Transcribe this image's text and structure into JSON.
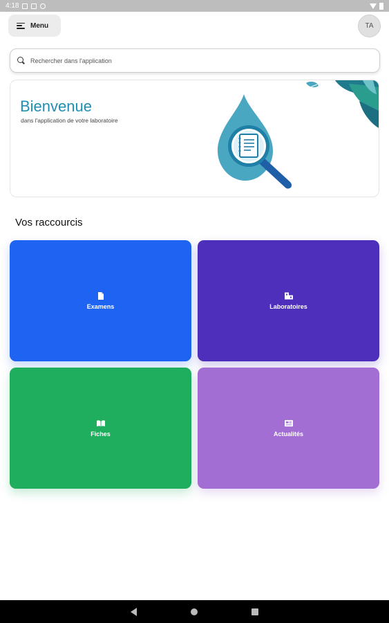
{
  "status_bar": {
    "time": "4:18",
    "icons": [
      "notification-icon",
      "sim-icon",
      "at-icon",
      "wifi-icon",
      "battery-icon"
    ]
  },
  "header": {
    "menu_label": "Menu",
    "avatar_initials": "TA"
  },
  "search": {
    "placeholder": "Rechercher dans l'application"
  },
  "welcome": {
    "title": "Bienvenue",
    "subtitle": "dans l'application de votre laboratoire"
  },
  "shortcuts": {
    "title": "Vos raccourcis",
    "items": [
      {
        "label": "Examens",
        "icon": "document-icon",
        "color": "#1f63f2"
      },
      {
        "label": "Laboratoires",
        "icon": "lab-icon",
        "color": "#4d2fbc"
      },
      {
        "label": "Fiches",
        "icon": "book-icon",
        "color": "#1eae5e"
      },
      {
        "label": "Actualités",
        "icon": "newspaper-icon",
        "color": "#a26ed4"
      }
    ]
  },
  "colors": {
    "accent": "#1f8fb3"
  }
}
